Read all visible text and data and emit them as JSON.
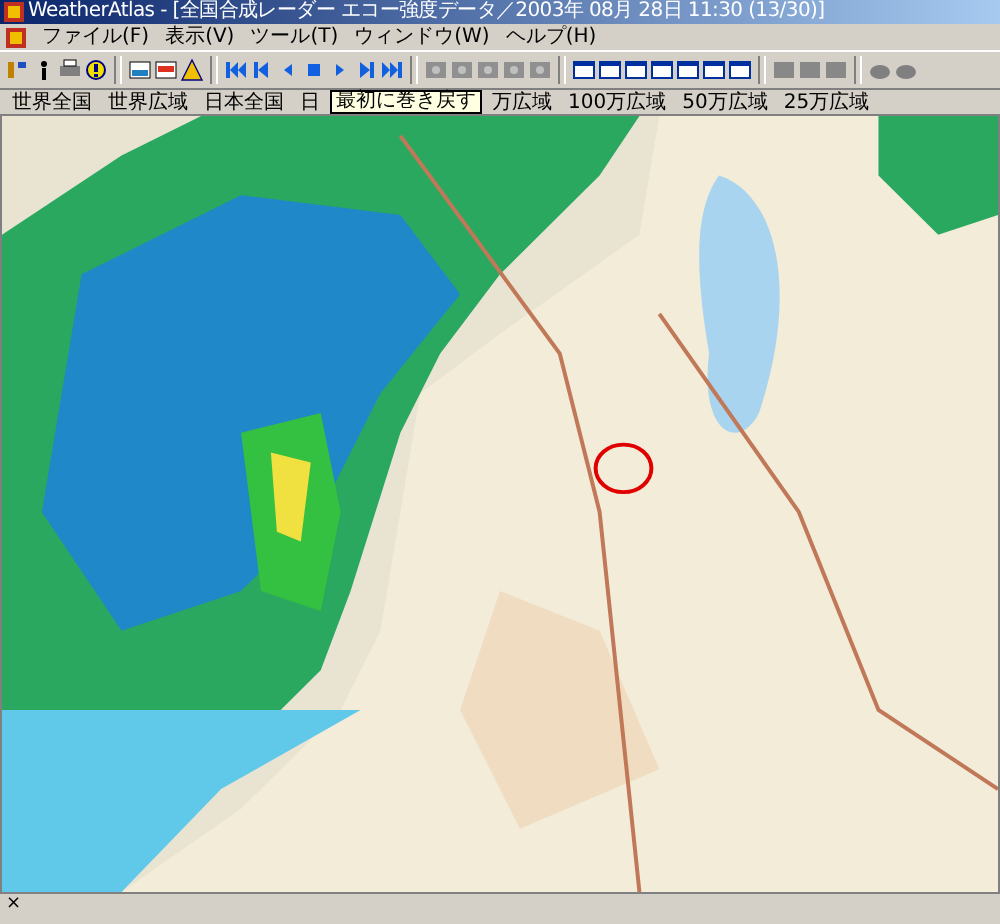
{
  "window": {
    "title": "WeatherAtlas - [全国合成レーダー エコー強度データ／2003年 08月 28日 11:30 (13/30)]"
  },
  "menu": [
    "ファイル(F)",
    "表示(V)",
    "ツール(T)",
    "ウィンドウ(W)",
    "ヘルプ(H)"
  ],
  "scale_buttons": [
    "世界全国",
    "世界広域",
    "日本全国",
    "日",
    "万広域",
    "100万広域",
    "50万広域",
    "25万広域"
  ],
  "tooltip": "最初に巻き戻す",
  "status_bar": {
    "close": "×"
  }
}
